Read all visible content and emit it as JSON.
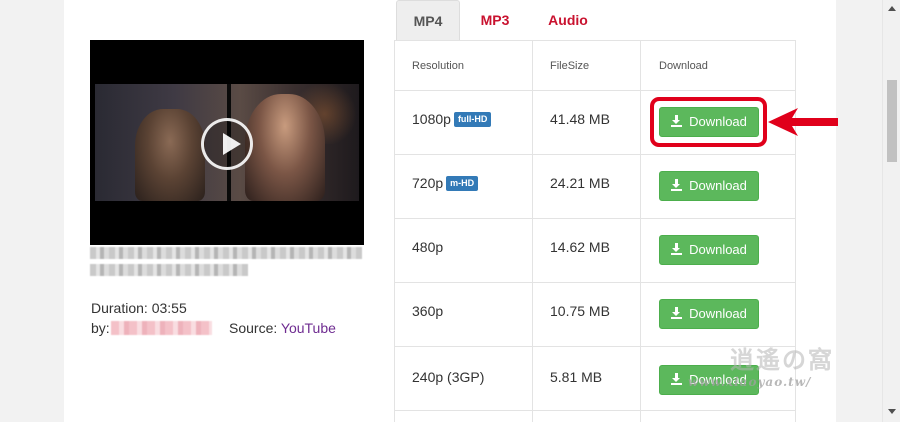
{
  "tabs": [
    {
      "label": "MP4",
      "active": true
    },
    {
      "label": "MP3",
      "active": false
    },
    {
      "label": "Audio",
      "active": false
    }
  ],
  "table": {
    "headers": [
      "Resolution",
      "FileSize",
      "Download"
    ],
    "rows": [
      {
        "resolution": "1080p",
        "badge": "full-HD",
        "filesize": "41.48 MB",
        "button": "Download",
        "highlighted": true
      },
      {
        "resolution": "720p",
        "badge": "m-HD",
        "filesize": "24.21 MB",
        "button": "Download",
        "highlighted": false
      },
      {
        "resolution": "480p",
        "badge": "",
        "filesize": "14.62 MB",
        "button": "Download",
        "highlighted": false
      },
      {
        "resolution": "360p",
        "badge": "",
        "filesize": "10.75 MB",
        "button": "Download",
        "highlighted": false
      },
      {
        "resolution": "240p (3GP)",
        "badge": "",
        "filesize": "5.81 MB",
        "button": "Download",
        "highlighted": false
      }
    ]
  },
  "video": {
    "duration_label": "Duration: 03:55",
    "by_label": "by:",
    "source_label": "Source:",
    "source_link": "YouTube"
  },
  "watermark": {
    "logo": "逍遙の窩",
    "url": "www.xiaoyao.tw/"
  },
  "icons": {
    "download": "download-icon",
    "play": "play-icon",
    "arrow": "red-arrow-pointer"
  },
  "colors": {
    "accent_red": "#c9122f",
    "button_green": "#5cb85c",
    "badge_blue": "#337ab7",
    "highlight_red": "#e0001b",
    "link_purple": "#6f2c91"
  }
}
